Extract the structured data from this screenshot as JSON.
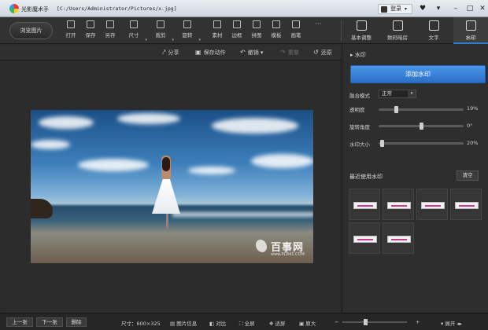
{
  "titlebar": {
    "app_name": "光影魔术手",
    "path": "[C:/Users/Administrator/Pictures/x.jpg]",
    "login": "登录"
  },
  "toolbar": {
    "browse": "浏览图片",
    "tools": [
      "打开",
      "保存",
      "另存",
      "尺寸",
      "裁剪",
      "旋转",
      "素材",
      "边框",
      "拼图",
      "模板",
      "画笔"
    ],
    "more": "···",
    "tabs": [
      "基本调整",
      "数码暗房",
      "文字",
      "水印"
    ]
  },
  "subbar": {
    "share": "分享",
    "save_action": "保存动作",
    "undo": "撤销",
    "redo": "重做",
    "restore": "还原"
  },
  "watermark_image": {
    "brand": "百事网",
    "site": "www.PC841.COM"
  },
  "panel": {
    "title": "水印",
    "add_button": "添加水印",
    "blend_label": "融合模式",
    "blend_value": "正常",
    "opacity_label": "透明度",
    "opacity_value": "19%",
    "opacity": 0.19,
    "angle_label": "旋转角度",
    "angle_value": "0°",
    "angle": 0.5,
    "size_label": "水印大小",
    "size_value": "20%",
    "size": 0.02,
    "recent_title": "最近使用水印",
    "clear": "清空"
  },
  "statusbar": {
    "prev": "上一张",
    "next": "下一张",
    "delete": "删除",
    "size_text": "尺寸：600×325",
    "info": "图片信息",
    "compare": "对比",
    "fullscreen": "全屏",
    "fit": "适屏",
    "original": "原大",
    "zoom_minus": "−",
    "zoom_plus": "+",
    "zoom": 0.35,
    "expand": "展开"
  },
  "colors": {
    "accent": "#2f7cd0",
    "background": "#2b2b2b"
  }
}
